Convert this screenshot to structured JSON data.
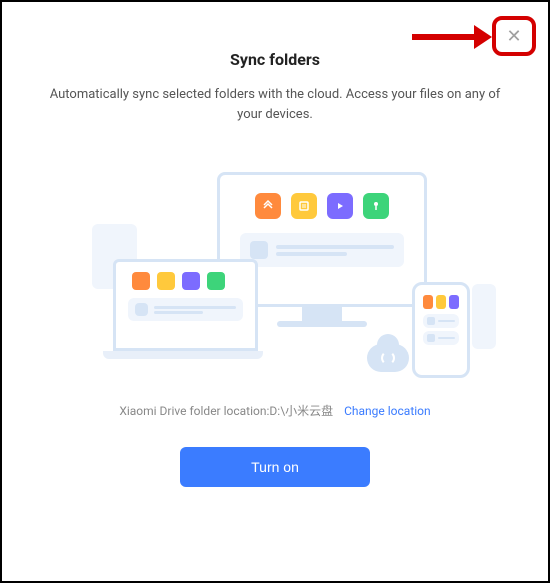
{
  "header": {
    "title": "Sync folders",
    "subtitle": "Automatically sync selected folders with the cloud. Access your files on any of your devices."
  },
  "location": {
    "label": "Xiaomi Drive folder location:",
    "path": "D:\\小米云盘",
    "change_link": "Change location"
  },
  "actions": {
    "turn_on": "Turn on"
  },
  "icons": {
    "close": "✕"
  },
  "colors": {
    "primary": "#3b7cff",
    "highlight": "#d40000"
  }
}
